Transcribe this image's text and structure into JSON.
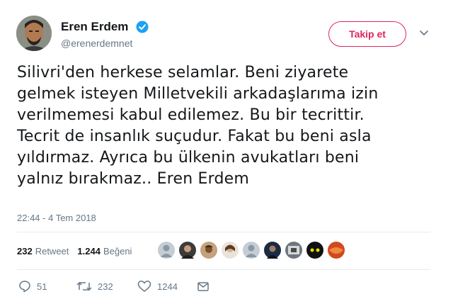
{
  "user": {
    "name": "Eren Erdem",
    "handle": "@erenerdemnet",
    "verified_color": "#1da1f2"
  },
  "header": {
    "follow_label": "Takip et",
    "follow_color": "#e0245e"
  },
  "tweet": {
    "lines": [
      "Silivri'den herkese selamlar. Beni ziyarete",
      "gelmek isteyen Milletvekili arkadaşlarıma izin",
      "verilmemesi kabul edilemez. Bu bir tecrittir.",
      "Tecrit de insanlık suçudur. Fakat bu beni asla",
      "yıldırmaz. Ayrıca bu ülkenin avukatları beni",
      "yalnız bırakmaz.. Eren Erdem"
    ],
    "timestamp": "22:44 - 4 Tem 2018"
  },
  "stats": {
    "retweet_count": "232",
    "retweet_label": "Retweet",
    "like_count": "1.244",
    "like_label": "Beğeni"
  },
  "likers": [
    {
      "icon": "avatar-default"
    },
    {
      "icon": "avatar-photo"
    },
    {
      "icon": "avatar-photo"
    },
    {
      "icon": "avatar-photo"
    },
    {
      "icon": "avatar-default"
    },
    {
      "icon": "avatar-photo"
    },
    {
      "icon": "avatar-photo"
    },
    {
      "icon": "avatar-photo"
    },
    {
      "icon": "avatar-photo"
    }
  ],
  "actions": {
    "reply_count": "51",
    "retweet_count": "232",
    "like_count": "1244"
  }
}
